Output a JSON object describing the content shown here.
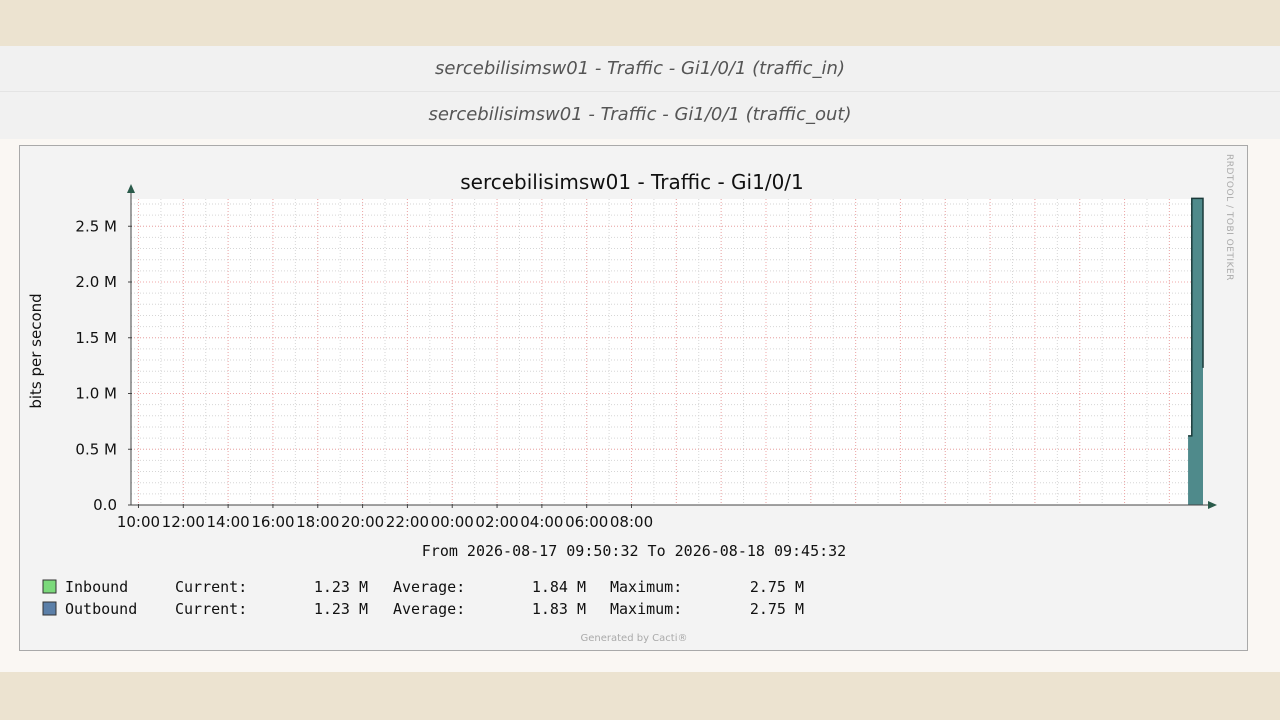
{
  "links": [
    {
      "label": "sercebilisimsw01 - Traffic - Gi1/0/1 (traffic_in)"
    },
    {
      "label": "sercebilisimsw01 - Traffic - Gi1/0/1 (traffic_out)"
    }
  ],
  "graph": {
    "watermark": "RRDTOOL / TOBI OETIKER",
    "period": "From 2026-08-17 09:50:32 To 2026-08-18 09:45:32",
    "footer": "Generated by Cacti®",
    "legend": [
      {
        "name": "Inbound",
        "color": "#7bd97b",
        "current_label": "Current:",
        "current": "1.23 M",
        "average_label": "Average:",
        "average": "1.84 M",
        "maximum_label": "Maximum:",
        "maximum": "2.75 M"
      },
      {
        "name": "Outbound",
        "color": "#5b7fa8",
        "current_label": "Current:",
        "current": "1.23 M",
        "average_label": "Average:",
        "average": "1.83 M",
        "maximum_label": "Maximum:",
        "maximum": "2.75 M"
      }
    ]
  },
  "chart_data": {
    "type": "area",
    "title": "sercebilisimsw01 - Traffic - Gi1/0/1",
    "ylabel": "bits per second",
    "xlabel": "",
    "ylim": [
      0,
      2.75
    ],
    "y_unit": "M",
    "yticks": [
      {
        "value": 0,
        "label": "0.0"
      },
      {
        "value": 0.5,
        "label": "0.5 M"
      },
      {
        "value": 1.0,
        "label": "1.0 M"
      },
      {
        "value": 1.5,
        "label": "1.5 M"
      },
      {
        "value": 2.0,
        "label": "2.0 M"
      },
      {
        "value": 2.5,
        "label": "2.5 M"
      }
    ],
    "xrange": [
      "2026-08-17 09:50",
      "2026-08-18 09:45"
    ],
    "xticks": [
      "10:00",
      "12:00",
      "14:00",
      "16:00",
      "18:00",
      "20:00",
      "22:00",
      "00:00",
      "02:00",
      "04:00",
      "06:00",
      "08:00"
    ],
    "grid": true,
    "series": [
      {
        "name": "Inbound",
        "color": "#7bd97b",
        "x": [
          "2026-08-18 09:25",
          "2026-08-18 09:30",
          "2026-08-18 09:35",
          "2026-08-18 09:40",
          "2026-08-18 09:45"
        ],
        "values": [
          0.62,
          2.75,
          2.75,
          2.75,
          1.23
        ]
      },
      {
        "name": "Outbound",
        "color": "#4f8a8b",
        "x": [
          "2026-08-18 09:25",
          "2026-08-18 09:30",
          "2026-08-18 09:35",
          "2026-08-18 09:40",
          "2026-08-18 09:45"
        ],
        "values": [
          0.62,
          2.75,
          2.75,
          2.75,
          1.23
        ]
      }
    ]
  }
}
